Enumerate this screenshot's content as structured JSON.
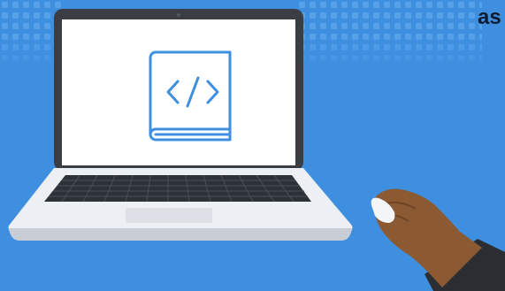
{
  "brand": {
    "text": "as"
  },
  "icons": {
    "screen_icon": "code-book-icon",
    "device": "laptop",
    "hand": "hand-with-mouse"
  },
  "colors": {
    "background": "#3e8fe0",
    "dot_pattern": "#5aa3ea",
    "laptop_body": "#eceff3",
    "laptop_bezel": "#3a3d44",
    "screen": "#ffffff",
    "icon_stroke": "#3e8fe0",
    "keyboard": "#2d3138",
    "skin": "#8b5a33",
    "sleeve": "#2a2e33",
    "mouse": "#f4f5f7",
    "brand_text": "#111b2e"
  }
}
